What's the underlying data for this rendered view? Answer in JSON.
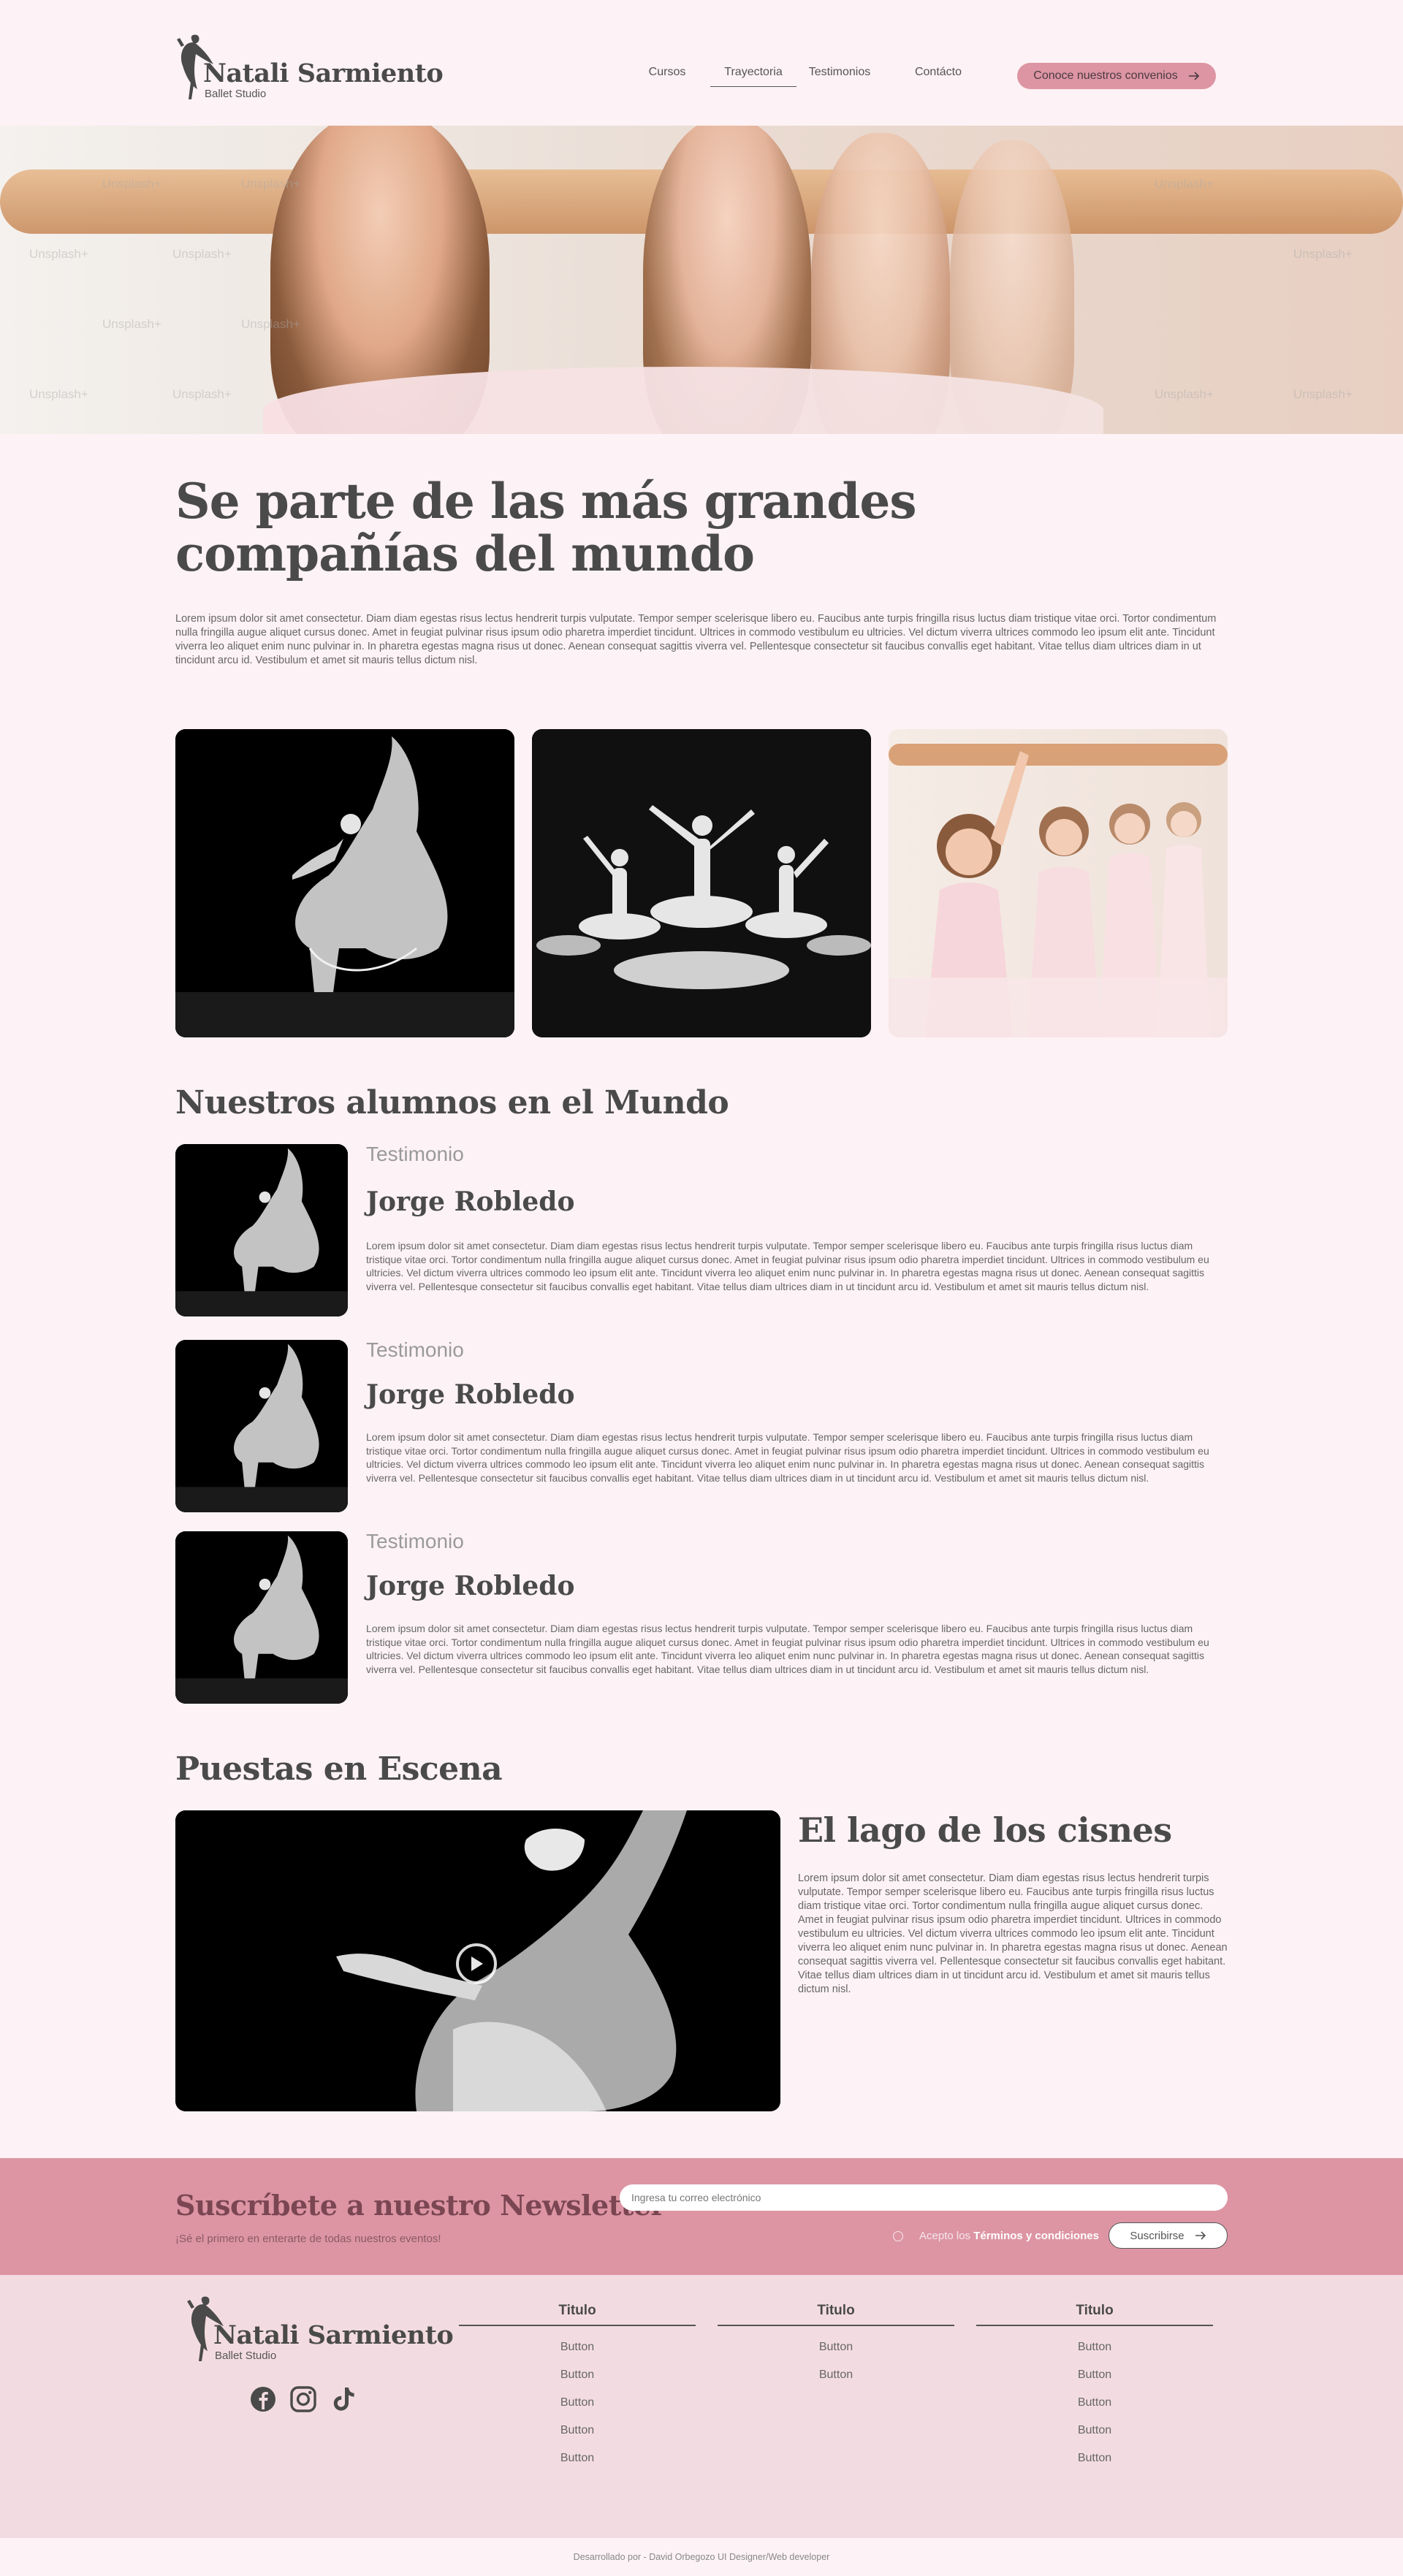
{
  "brand": {
    "name": "Natali Sarmiento",
    "subtitle": "Ballet Studio"
  },
  "nav": {
    "links": [
      "Cursos",
      "Trayectoria",
      "Testimonios",
      "Contácto"
    ],
    "active": "Trayectoria",
    "cta_label": "Conoce nuestros convenios"
  },
  "hero": {
    "watermark": "Unsplash+"
  },
  "intro": {
    "title": "Se parte de las más grandes compañías del mundo",
    "text": "Lorem ipsum dolor sit amet consectetur. Diam diam egestas risus lectus hendrerit turpis vulputate. Tempor semper scelerisque libero eu. Faucibus ante turpis fringilla risus luctus diam tristique vitae orci. Tortor condimentum nulla fringilla augue aliquet cursus donec. Amet in feugiat pulvinar risus ipsum odio pharetra imperdiet tincidunt. Ultrices in commodo vestibulum eu ultricies. Vel dictum viverra ultrices commodo leo ipsum elit ante. Tincidunt viverra leo aliquet enim nunc pulvinar in. In pharetra egestas magna risus ut donec. Aenean consequat sagittis viverra vel. Pellentesque consectetur sit faucibus convallis eget habitant. Vitae tellus diam ultrices diam in ut tincidunt arcu id. Vestibulum et amet sit mauris tellus dictum nisl."
  },
  "testimonials": {
    "title": "Nuestros alumnos en el Mundo",
    "items": [
      {
        "label": "Testimonio",
        "name": "Jorge Robledo",
        "text": "Lorem ipsum dolor sit amet consectetur. Diam diam egestas risus lectus hendrerit turpis vulputate. Tempor semper scelerisque libero eu. Faucibus ante turpis fringilla risus luctus diam tristique vitae orci. Tortor condimentum nulla fringilla augue aliquet cursus donec. Amet in feugiat pulvinar risus ipsum odio pharetra imperdiet tincidunt. Ultrices in commodo vestibulum eu ultricies. Vel dictum viverra ultrices commodo leo ipsum elit ante. Tincidunt viverra leo aliquet enim nunc pulvinar in. In pharetra egestas magna risus ut donec. Aenean consequat sagittis viverra vel. Pellentesque consectetur sit faucibus convallis eget habitant. Vitae tellus diam ultrices diam in ut tincidunt arcu id. Vestibulum et amet sit mauris tellus dictum nisl."
      },
      {
        "label": "Testimonio",
        "name": "Jorge Robledo",
        "text": "Lorem ipsum dolor sit amet consectetur. Diam diam egestas risus lectus hendrerit turpis vulputate. Tempor semper scelerisque libero eu. Faucibus ante turpis fringilla risus luctus diam tristique vitae orci. Tortor condimentum nulla fringilla augue aliquet cursus donec. Amet in feugiat pulvinar risus ipsum odio pharetra imperdiet tincidunt. Ultrices in commodo vestibulum eu ultricies. Vel dictum viverra ultrices commodo leo ipsum elit ante. Tincidunt viverra leo aliquet enim nunc pulvinar in. In pharetra egestas magna risus ut donec. Aenean consequat sagittis viverra vel. Pellentesque consectetur sit faucibus convallis eget habitant. Vitae tellus diam ultrices diam in ut tincidunt arcu id. Vestibulum et amet sit mauris tellus dictum nisl."
      },
      {
        "label": "Testimonio",
        "name": "Jorge Robledo",
        "text": "Lorem ipsum dolor sit amet consectetur. Diam diam egestas risus lectus hendrerit turpis vulputate. Tempor semper scelerisque libero eu. Faucibus ante turpis fringilla risus luctus diam tristique vitae orci. Tortor condimentum nulla fringilla augue aliquet cursus donec. Amet in feugiat pulvinar risus ipsum odio pharetra imperdiet tincidunt. Ultrices in commodo vestibulum eu ultricies. Vel dictum viverra ultrices commodo leo ipsum elit ante. Tincidunt viverra leo aliquet enim nunc pulvinar in. In pharetra egestas magna risus ut donec. Aenean consequat sagittis viverra vel. Pellentesque consectetur sit faucibus convallis eget habitant. Vitae tellus diam ultrices diam in ut tincidunt arcu id. Vestibulum et amet sit mauris tellus dictum nisl."
      }
    ]
  },
  "puestas": {
    "title": "Puestas en Escena",
    "show_title": "El lago de los cisnes",
    "text": "Lorem ipsum dolor sit amet consectetur. Diam diam egestas risus lectus hendrerit turpis vulputate. Tempor semper scelerisque libero eu. Faucibus ante turpis fringilla risus luctus diam tristique vitae orci. Tortor condimentum nulla fringilla augue aliquet cursus donec. Amet in feugiat pulvinar risus ipsum odio pharetra imperdiet tincidunt. Ultrices in commodo vestibulum eu ultricies. Vel dictum viverra ultrices commodo leo ipsum elit ante. Tincidunt viverra leo aliquet enim nunc pulvinar in. In pharetra egestas magna risus ut donec. Aenean consequat sagittis viverra vel. Pellentesque consectetur sit faucibus convallis eget habitant. Vitae tellus diam ultrices diam in ut tincidunt arcu id. Vestibulum et amet sit mauris tellus dictum nisl."
  },
  "newsletter": {
    "title": "Suscríbete a nuestro Newsletter",
    "subtitle": "¡Sé el primero en enterarte de todas nuestros eventos!",
    "placeholder": "Ingresa tu correo electrónico",
    "terms_prefix": "Acepto los",
    "terms_link": "Términos y condiciones",
    "button": "Suscribirse"
  },
  "footer": {
    "social_icons": [
      "facebook-icon",
      "instagram-icon",
      "tiktok-icon"
    ],
    "columns": [
      {
        "title": "Titulo",
        "items": [
          "Button",
          "Button",
          "Button",
          "Button",
          "Button"
        ]
      },
      {
        "title": "Titulo",
        "items": [
          "Button",
          "Button"
        ]
      },
      {
        "title": "Titulo",
        "items": [
          "Button",
          "Button",
          "Button",
          "Button",
          "Button"
        ]
      }
    ],
    "credit": "Desarrollado por - David Orbegozo UI Designer/Web developer"
  },
  "colors": {
    "background": "#fdf2f5",
    "accent": "#dd95a3",
    "footer": "#f3dce1",
    "text": "#4a4a4a"
  }
}
